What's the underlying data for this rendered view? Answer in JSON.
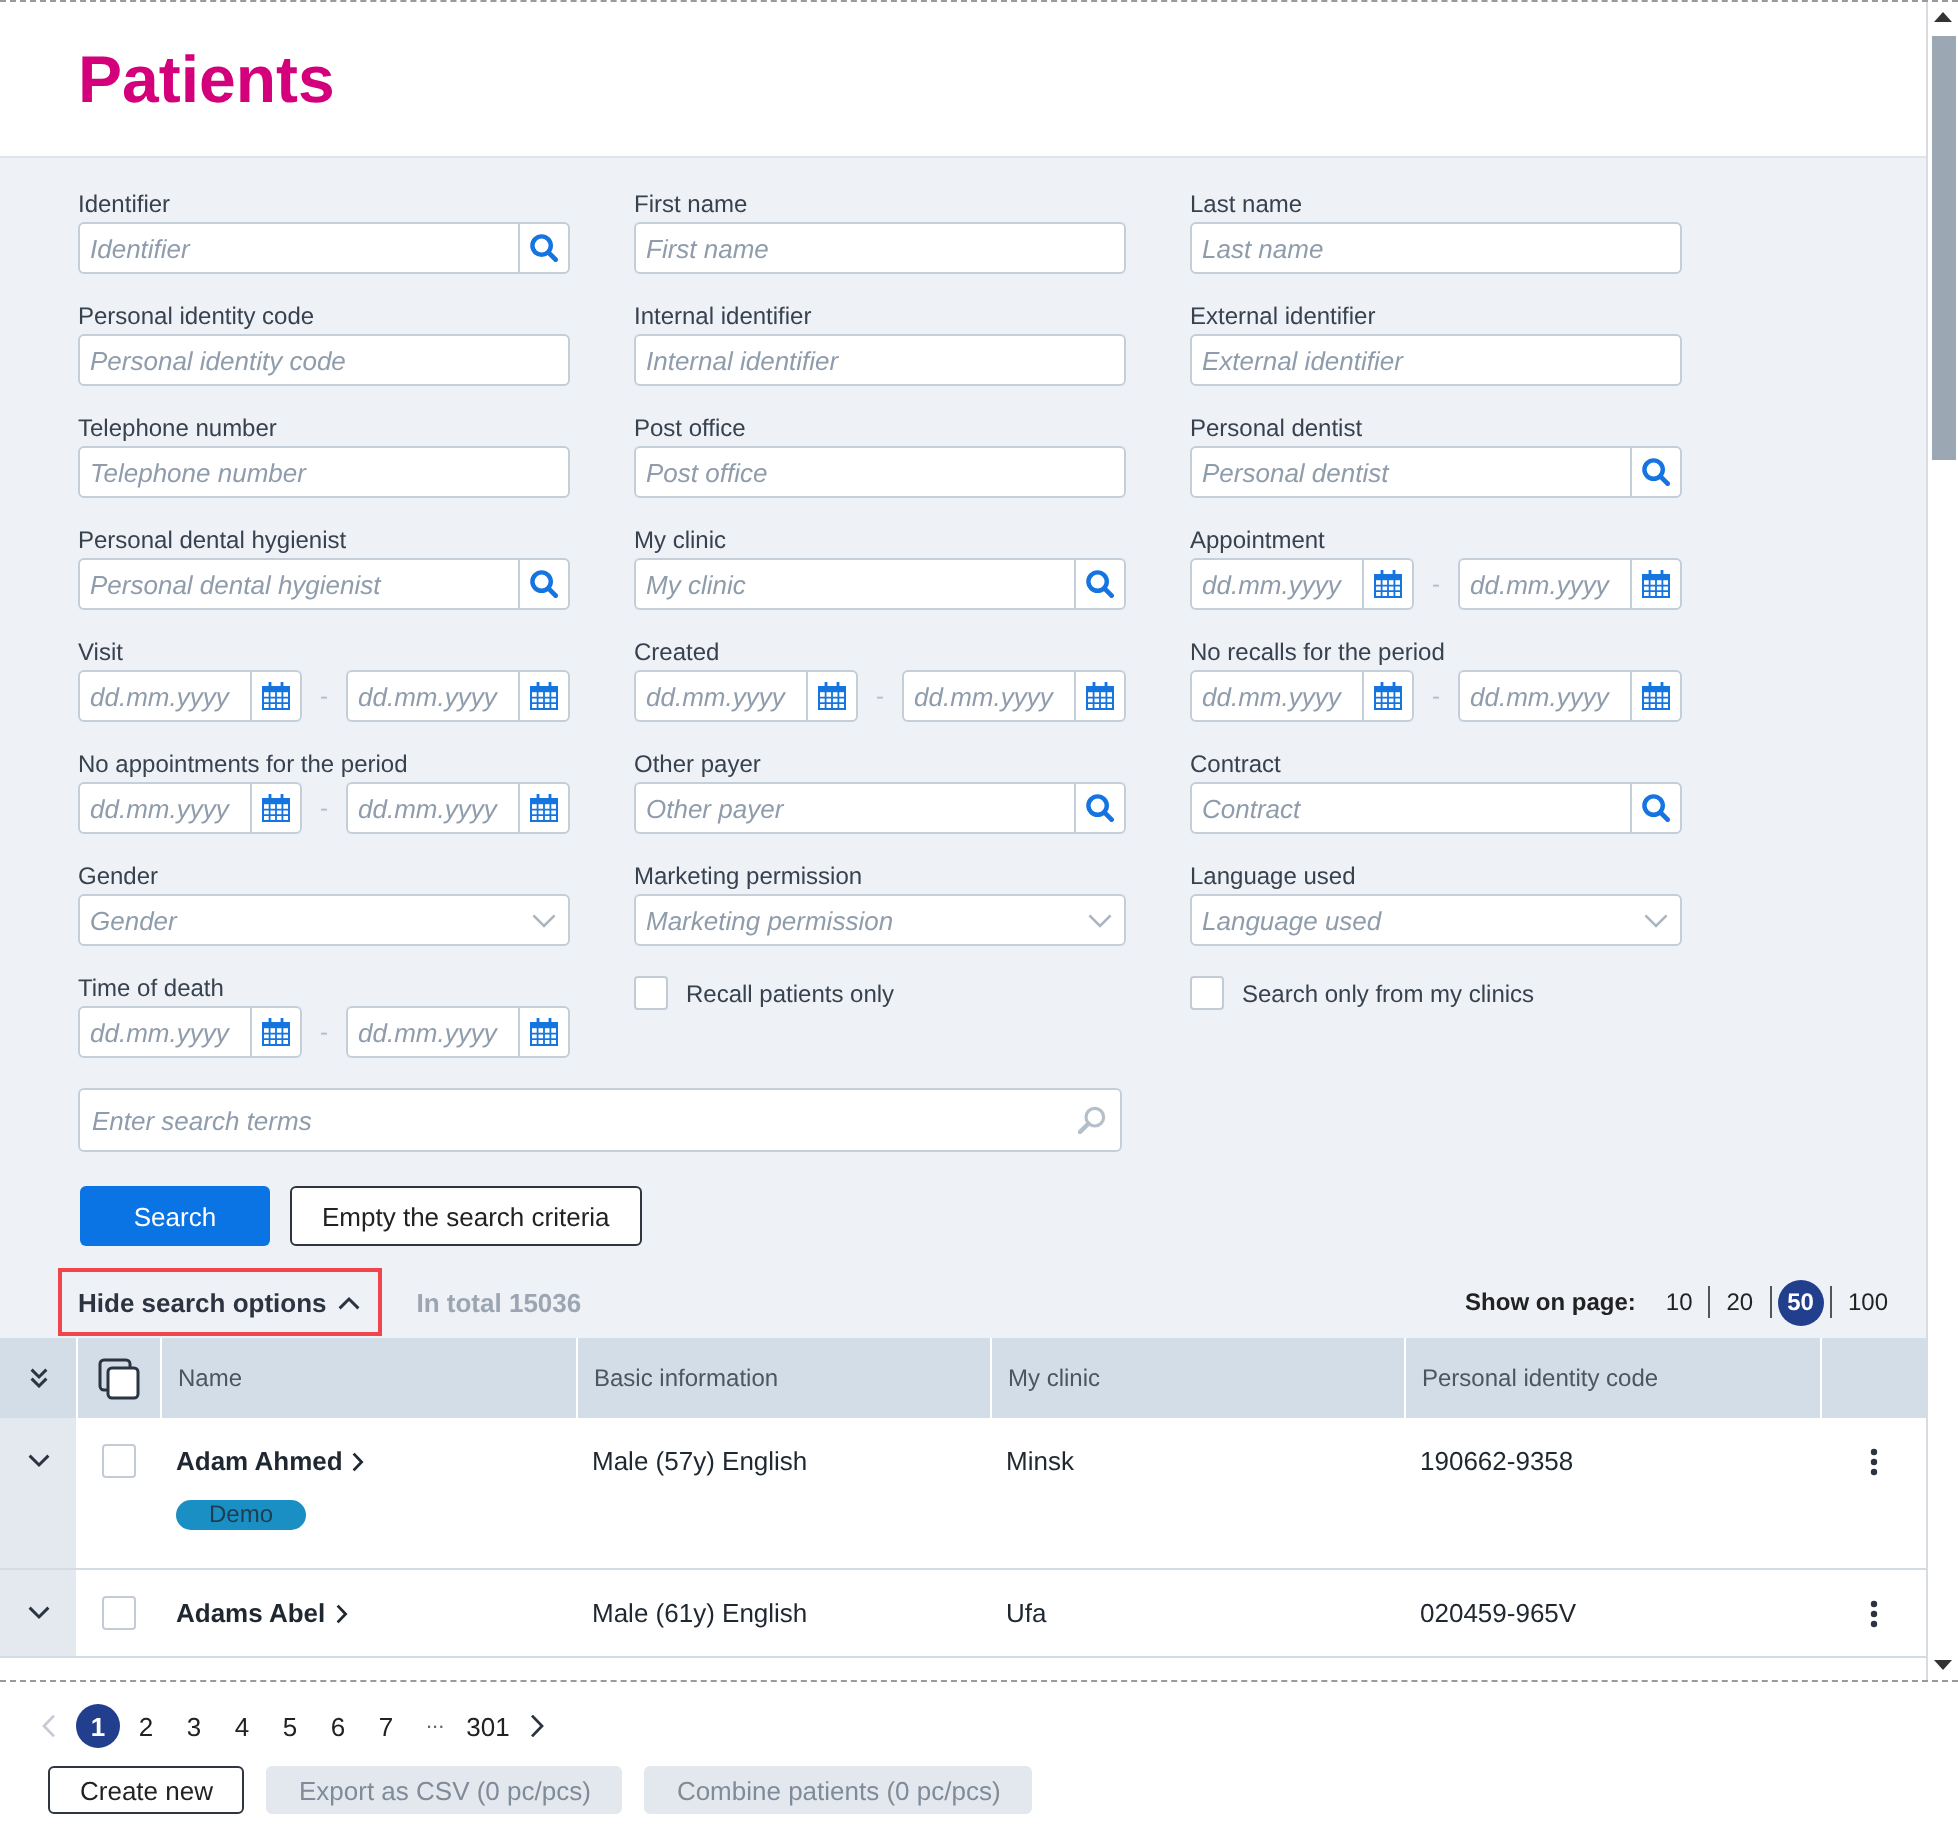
{
  "page": {
    "title": "Patients"
  },
  "filters": [
    {
      "kind": "search",
      "label": "Identifier",
      "placeholder": "Identifier"
    },
    {
      "kind": "text",
      "label": "First name",
      "placeholder": "First name"
    },
    {
      "kind": "text",
      "label": "Last name",
      "placeholder": "Last name"
    },
    {
      "kind": "text",
      "label": "Personal identity code",
      "placeholder": "Personal identity code"
    },
    {
      "kind": "text",
      "label": "Internal identifier",
      "placeholder": "Internal identifier"
    },
    {
      "kind": "text",
      "label": "External identifier",
      "placeholder": "External identifier"
    },
    {
      "kind": "text",
      "label": "Telephone number",
      "placeholder": "Telephone number"
    },
    {
      "kind": "text",
      "label": "Post office",
      "placeholder": "Post office"
    },
    {
      "kind": "search",
      "label": "Personal dentist",
      "placeholder": "Personal dentist"
    },
    {
      "kind": "search",
      "label": "Personal dental hygienist",
      "placeholder": "Personal dental hygienist"
    },
    {
      "kind": "search",
      "label": "My clinic",
      "placeholder": "My clinic"
    },
    {
      "kind": "date_range",
      "label": "Appointment",
      "from": {
        "placeholder": "dd.mm.yyyy"
      },
      "separator": "-",
      "to": {
        "placeholder": "dd.mm.yyyy"
      }
    },
    {
      "kind": "date_range",
      "label": "Visit",
      "from": {
        "placeholder": "dd.mm.yyyy"
      },
      "separator": "-",
      "to": {
        "placeholder": "dd.mm.yyyy"
      }
    },
    {
      "kind": "date_range",
      "label": "Created",
      "from": {
        "placeholder": "dd.mm.yyyy"
      },
      "separator": "-",
      "to": {
        "placeholder": "dd.mm.yyyy"
      }
    },
    {
      "kind": "date_range",
      "label": "No recalls for the period",
      "from": {
        "placeholder": "dd.mm.yyyy"
      },
      "separator": "-",
      "to": {
        "placeholder": "dd.mm.yyyy"
      }
    },
    {
      "kind": "date_range",
      "label": "No appointments for the period",
      "from": {
        "placeholder": "dd.mm.yyyy"
      },
      "separator": "-",
      "to": {
        "placeholder": "dd.mm.yyyy"
      }
    },
    {
      "kind": "search",
      "label": "Other payer",
      "placeholder": "Other payer"
    },
    {
      "kind": "search",
      "label": "Contract",
      "placeholder": "Contract"
    },
    {
      "kind": "select",
      "label": "Gender",
      "placeholder": "Gender"
    },
    {
      "kind": "select",
      "label": "Marketing permission",
      "placeholder": "Marketing permission"
    },
    {
      "kind": "select",
      "label": "Language used",
      "placeholder": "Language used"
    },
    {
      "kind": "date_range",
      "label": "Time of death",
      "from": {
        "placeholder": "dd.mm.yyyy"
      },
      "separator": "-",
      "to": {
        "placeholder": "dd.mm.yyyy"
      }
    },
    {
      "kind": "checkbox",
      "label": "Recall patients only",
      "checked": false
    },
    {
      "kind": "checkbox",
      "label": "Search only from my clinics",
      "checked": false
    }
  ],
  "search_terms": {
    "placeholder": "Enter search terms"
  },
  "actions": [
    {
      "kind": "primary",
      "label": "Search"
    },
    {
      "kind": "secondary",
      "label": "Empty the search criteria"
    }
  ],
  "results_bar": {
    "toggle": {
      "label": "Hide search options",
      "highlighted": true
    },
    "total": "In total 15036",
    "page_size": {
      "label": "Show on page:",
      "options": [
        {
          "label": "10",
          "selected": false
        },
        {
          "label": "20",
          "selected": false
        },
        {
          "label": "50",
          "selected": true
        },
        {
          "label": "100",
          "selected": false
        }
      ]
    }
  },
  "table": {
    "columns": [
      {
        "label": "Name"
      },
      {
        "label": "Basic information"
      },
      {
        "label": "My clinic"
      },
      {
        "label": "Personal identity code"
      }
    ],
    "rows": [
      {
        "expanded": false,
        "checked": false,
        "name": "Adam Ahmed",
        "tags": [
          {
            "label": "Demo"
          }
        ],
        "basic_information": "Male (57y) English",
        "my_clinic": "Minsk",
        "personal_identity_code": "190662-9358"
      },
      {
        "expanded": false,
        "checked": false,
        "name": "Adams Abel",
        "basic_information": "Male (61y) English",
        "my_clinic": "Ufa",
        "personal_identity_code": "020459-965V"
      }
    ]
  },
  "pagination": {
    "previous": {
      "disabled": true
    },
    "pages": [
      {
        "kind": "page",
        "label": "1",
        "selected": true
      },
      {
        "kind": "page",
        "label": "2",
        "selected": false
      },
      {
        "kind": "page",
        "label": "3",
        "selected": false
      },
      {
        "kind": "page",
        "label": "4",
        "selected": false
      },
      {
        "kind": "page",
        "label": "5",
        "selected": false
      },
      {
        "kind": "page",
        "label": "6",
        "selected": false
      },
      {
        "kind": "page",
        "label": "7",
        "selected": false
      },
      {
        "kind": "ellipsis",
        "label": "...",
        "selected": false
      },
      {
        "kind": "page",
        "label": "301",
        "selected": false
      }
    ],
    "next": {
      "disabled": false
    }
  },
  "footer_buttons": [
    {
      "label": "Create new",
      "disabled": false
    },
    {
      "label": "Export as CSV (0 pc/pcs)",
      "disabled": true
    },
    {
      "label": "Combine patients (0 pc/pcs)",
      "disabled": true
    }
  ]
}
